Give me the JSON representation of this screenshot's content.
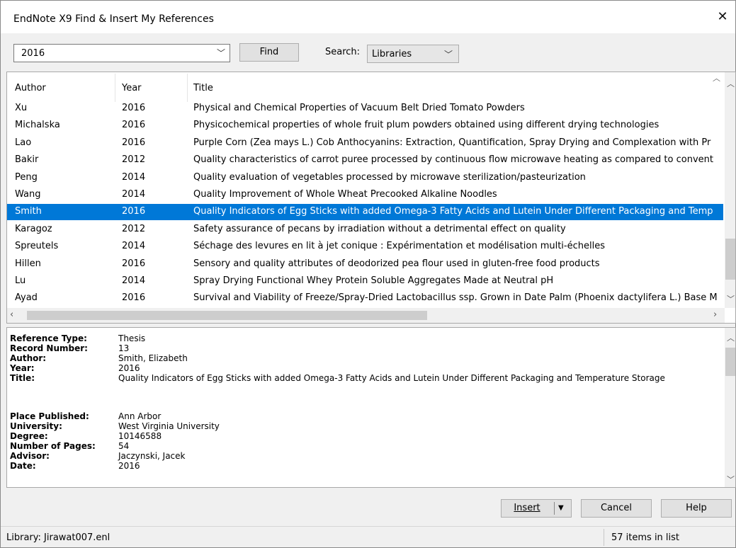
{
  "window": {
    "title": "EndNote X9 Find & Insert My References",
    "close_glyph": "✕"
  },
  "toolbar": {
    "query_value": "2016",
    "find_label": "Find",
    "search_label": "Search:",
    "search_scope": "Libraries"
  },
  "list": {
    "columns": [
      "Author",
      "Year",
      "Title"
    ],
    "rows": [
      {
        "author": "Xu",
        "year": "2016",
        "title": "Physical and Chemical Properties of Vacuum Belt Dried Tomato Powders"
      },
      {
        "author": "Michalska",
        "year": "2016",
        "title": "Physicochemical properties of whole fruit plum powders obtained using different drying technologies"
      },
      {
        "author": "Lao",
        "year": "2016",
        "title": "Purple Corn (Zea mays L.) Cob Anthocyanins: Extraction, Quantification, Spray Drying and Complexation with Pr"
      },
      {
        "author": "Bakir",
        "year": "2012",
        "title": "Quality characteristics of carrot puree processed by continuous flow microwave heating as compared to convent"
      },
      {
        "author": "Peng",
        "year": "2014",
        "title": "Quality evaluation of vegetables processed by microwave sterilization/pasteurization"
      },
      {
        "author": "Wang",
        "year": "2014",
        "title": "Quality Improvement of Whole Wheat Precooked Alkaline Noodles"
      },
      {
        "author": "Smith",
        "year": "2016",
        "title": "Quality Indicators of Egg Sticks with added Omega-3 Fatty Acids and Lutein Under Different Packaging and Temp"
      },
      {
        "author": "Karagoz",
        "year": "2012",
        "title": "Safety assurance of pecans by irradiation without a detrimental effect on quality"
      },
      {
        "author": "Spreutels",
        "year": "2014",
        "title": "Séchage des levures en lit à jet conique : Expérimentation et modélisation multi-échelles"
      },
      {
        "author": "Hillen",
        "year": "2016",
        "title": "Sensory and quality attributes of deodorized pea flour used in gluten-free food products"
      },
      {
        "author": "Lu",
        "year": "2014",
        "title": "Spray Drying Functional Whey Protein Soluble Aggregates Made at Neutral pH"
      },
      {
        "author": "Ayad",
        "year": "2016",
        "title": "Survival and Viability of Freeze/Spray-Dried Lactobacillus ssp. Grown in Date Palm (Phoenix dactylifera L.) Base M"
      }
    ],
    "selected_index": 6,
    "selection_color": "#0078d7"
  },
  "details": [
    {
      "label": "Reference Type:",
      "value": "Thesis"
    },
    {
      "label": "Record Number:",
      "value": "13"
    },
    {
      "label": "Author:",
      "value": "Smith, Elizabeth"
    },
    {
      "label": "Year:",
      "value": "2016"
    },
    {
      "label": "Title:",
      "value": "Quality Indicators of Egg Sticks with added Omega-3 Fatty Acids and Lutein Under Different Packaging and Temperature Storage"
    },
    {
      "label": "Place Published:",
      "value": "Ann Arbor"
    },
    {
      "label": "University:",
      "value": "West Virginia University"
    },
    {
      "label": "Degree:",
      "value": "10146588"
    },
    {
      "label": "Number of Pages:",
      "value": "54"
    },
    {
      "label": "Advisor:",
      "value": "Jaczynski, Jacek"
    },
    {
      "label": "Date:",
      "value": "2016"
    }
  ],
  "buttons": {
    "insert": "Insert",
    "cancel": "Cancel",
    "help": "Help"
  },
  "status": {
    "library": "Library: Jirawat007.enl",
    "count": "57 items in list"
  }
}
